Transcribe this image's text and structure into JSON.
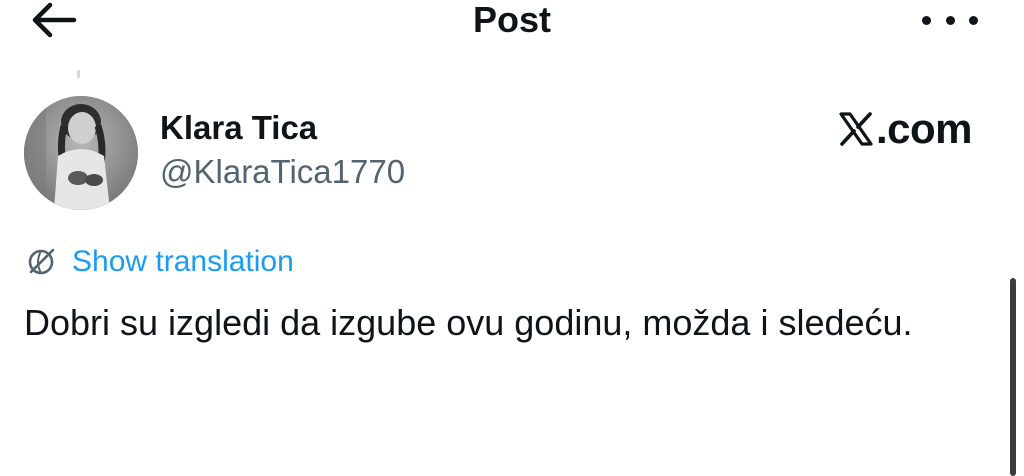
{
  "header": {
    "title": "Post",
    "back_icon": "arrow-left-icon",
    "more_icon": "more-dots-icon"
  },
  "author": {
    "display_name": "Klara Tica",
    "handle": "@KlaraTica1770",
    "avatar": "vintage-photo-avatar"
  },
  "watermark": {
    "logo_letter": "X",
    "text": ".com"
  },
  "translation": {
    "icon": "globe-slash-icon",
    "label": "Show translation"
  },
  "post": {
    "text": "Dobri su izgledi da izgube ovu godinu, možda i sledeću."
  },
  "colors": {
    "text": "#0f1419",
    "secondary": "#536471",
    "accent": "#1d9bf0",
    "background": "#ffffff"
  }
}
